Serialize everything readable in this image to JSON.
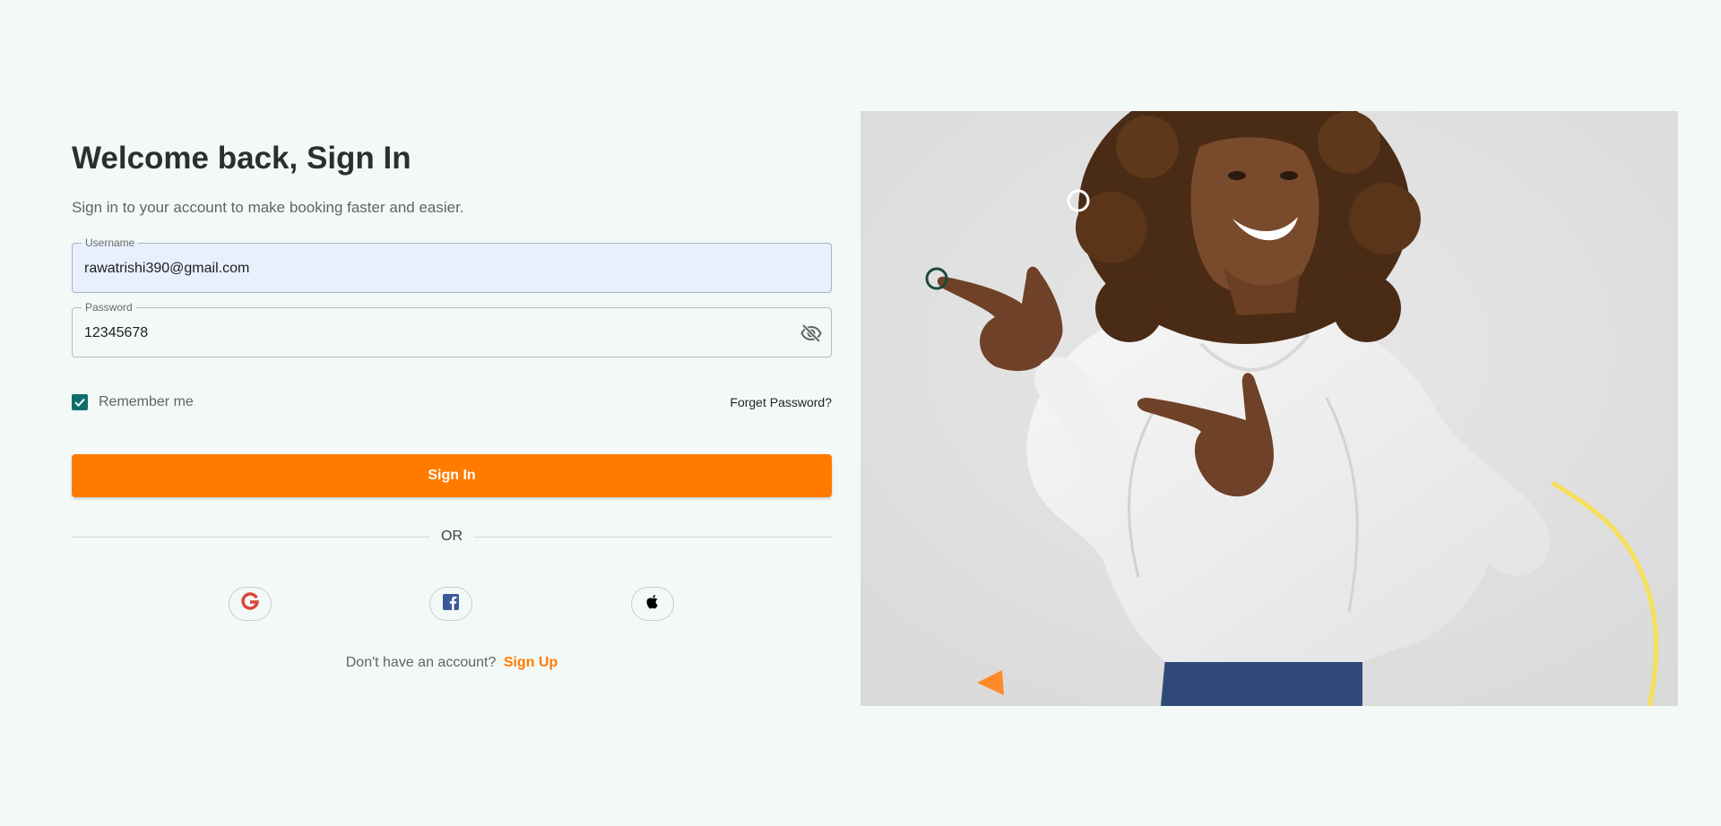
{
  "signin": {
    "title": "Welcome back, Sign In",
    "subtitle": "Sign in to your account to make booking faster and easier.",
    "username": {
      "label": "Username",
      "value": "rawatrishi390@gmail.com"
    },
    "password": {
      "label": "Password",
      "value": "12345678",
      "visibility_icon": "eye-off-icon"
    },
    "remember_me": {
      "label": "Remember me",
      "checked": true
    },
    "forgot_label": "Forget Password?",
    "submit_label": "Sign In",
    "divider_label": "OR",
    "social_icons": [
      "google-icon",
      "facebook-icon",
      "apple-icon"
    ],
    "signup_prompt": "Don't have an account?",
    "signup_link": "Sign Up"
  },
  "colors": {
    "background": "#f3f9f7",
    "accent": "#ff7b00",
    "checkbox": "#0d6f6b",
    "autofill": "#e8f0fe"
  }
}
